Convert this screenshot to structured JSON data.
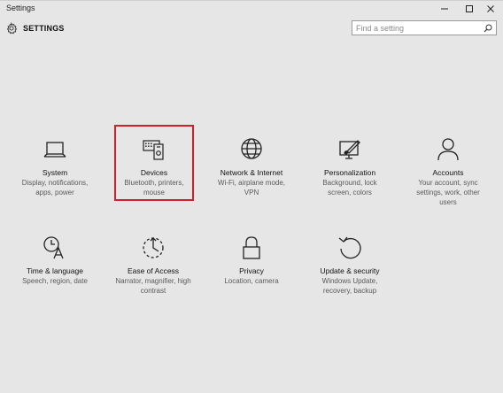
{
  "window": {
    "title": "Settings"
  },
  "header": {
    "title": "SETTINGS",
    "search_placeholder": "Find a setting"
  },
  "accent_colors": {
    "highlight_border": "#d0202a",
    "background": "#e6e6e6"
  },
  "tiles": [
    {
      "name": "System",
      "desc": "Display, notifications, apps, power",
      "icon": "laptop-icon"
    },
    {
      "name": "Devices",
      "desc": "Bluetooth, printers, mouse",
      "icon": "devices-icon",
      "highlighted": true
    },
    {
      "name": "Network & Internet",
      "desc": "Wi-Fi, airplane mode, VPN",
      "icon": "globe-icon"
    },
    {
      "name": "Personalization",
      "desc": "Background, lock screen, colors",
      "icon": "personalization-icon"
    },
    {
      "name": "Accounts",
      "desc": "Your account, sync settings, work, other users",
      "icon": "person-icon"
    },
    {
      "name": "Time & language",
      "desc": "Speech, region, date",
      "icon": "time-language-icon"
    },
    {
      "name": "Ease of Access",
      "desc": "Narrator, magnifier, high contrast",
      "icon": "ease-of-access-icon"
    },
    {
      "name": "Privacy",
      "desc": "Location, camera",
      "icon": "lock-icon"
    },
    {
      "name": "Update & security",
      "desc": "Windows Update, recovery, backup",
      "icon": "refresh-icon"
    }
  ]
}
